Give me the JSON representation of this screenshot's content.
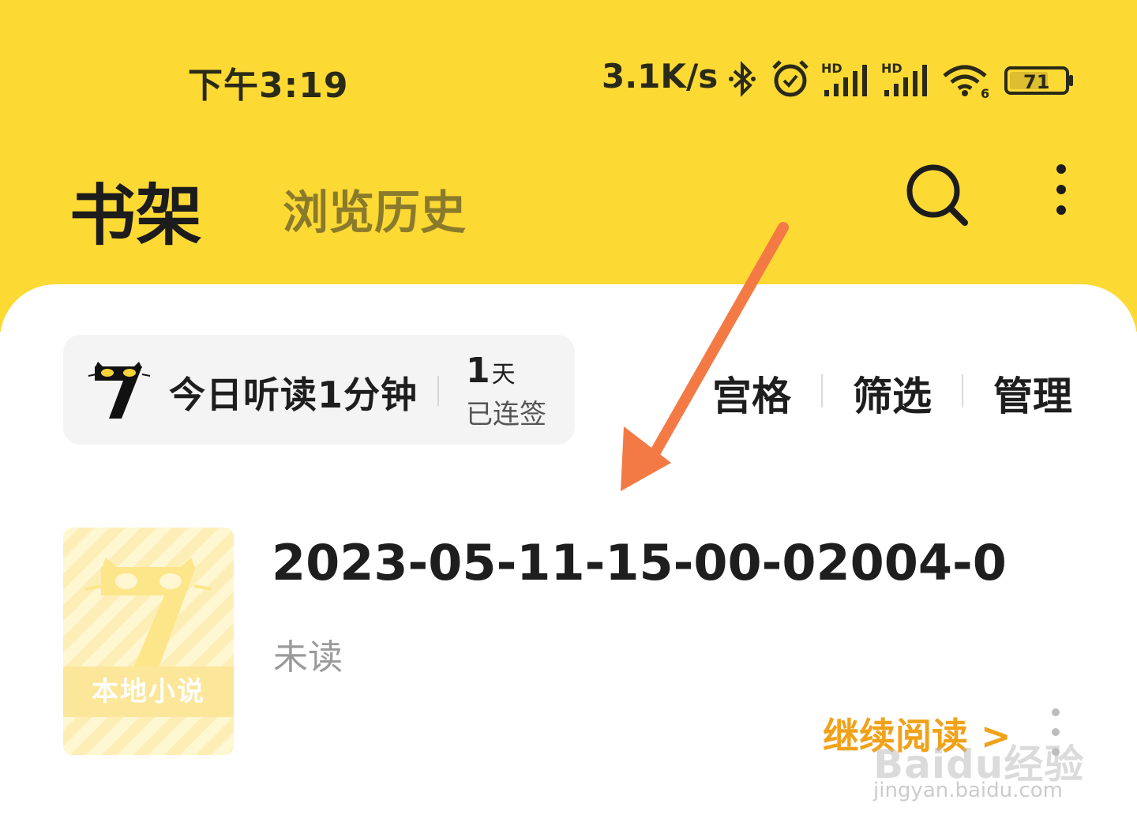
{
  "status_bar": {
    "time": "下午3:19",
    "net_speed": "3.1K/s",
    "signal_label_1": "HD",
    "signal_label_2": "HD",
    "wifi_label": "6",
    "battery": "71",
    "icons": [
      "bluetooth-icon",
      "alarm-icon",
      "signal-icon",
      "signal-icon",
      "wifi-icon",
      "battery-icon"
    ]
  },
  "header": {
    "tab_active": "书架",
    "tab_inactive": "浏览历史",
    "icons": [
      "search-icon",
      "more-vertical-icon"
    ]
  },
  "checkin": {
    "listen_text": "今日听读1分钟",
    "days_number": "1",
    "days_unit": "天",
    "days_label": "已连签",
    "logo_icon": "cat-logo-icon"
  },
  "toolbar": {
    "grid": "宫格",
    "filter": "筛选",
    "manage": "管理"
  },
  "book": {
    "cover_label": "本地小说",
    "title": "2023-05-11-15-00-02004-0",
    "status": "未读",
    "continue": "继续阅读 >"
  },
  "watermark": {
    "main": "Baidu经验",
    "sub": "jingyan.baidu.com"
  },
  "colors": {
    "header_bg": "#fdd934",
    "accent_orange": "#f0a21a",
    "arrow": "#f47a45"
  }
}
